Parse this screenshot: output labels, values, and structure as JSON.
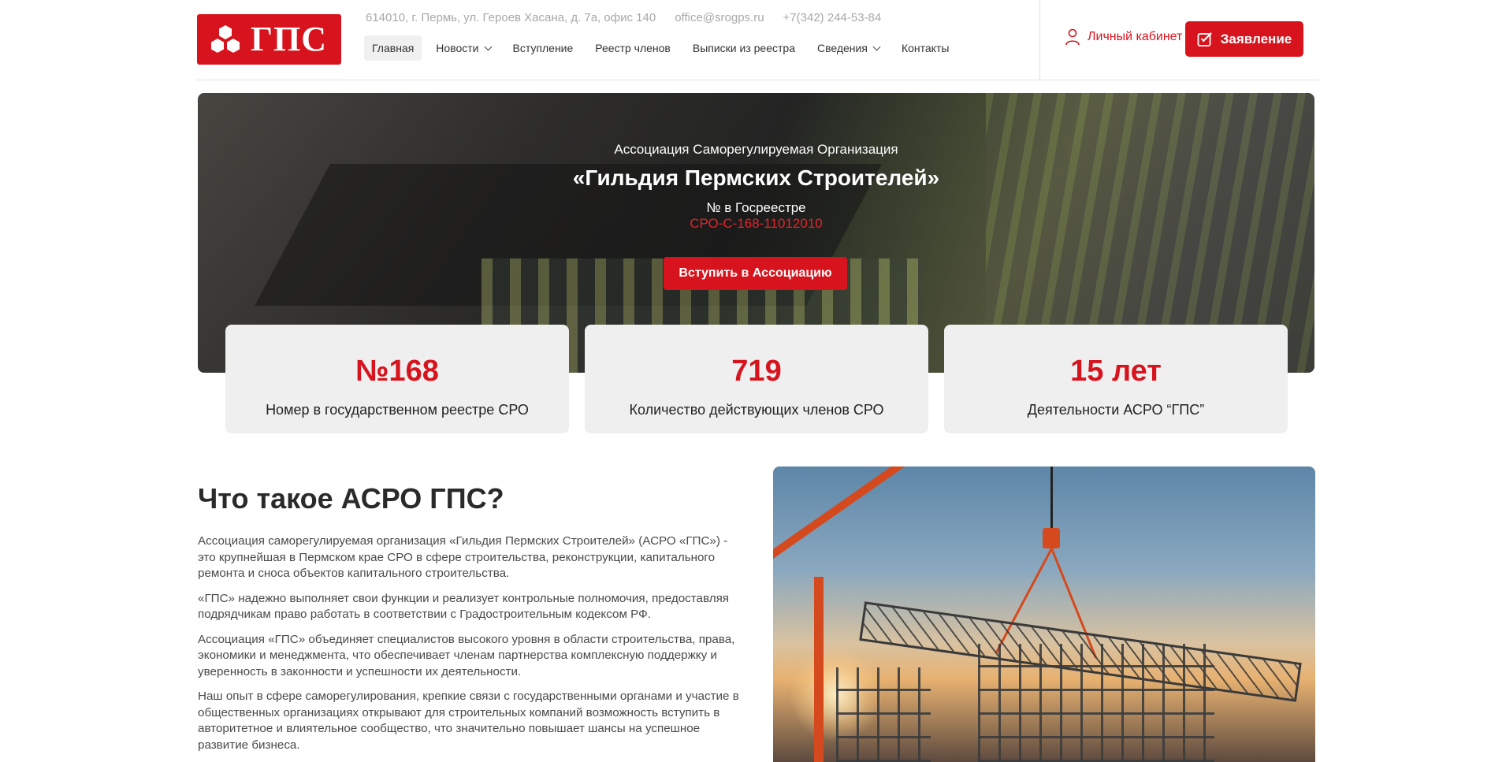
{
  "brand": {
    "logo_text": "ГПС",
    "accent": "#d7141d"
  },
  "header": {
    "address": "614010, г. Пермь, ул. Героев Хасана, д. 7а, офис 140",
    "email": "office@srogps.ru",
    "phone": "+7(342) 244-53-84",
    "nav": [
      {
        "label": "Главная",
        "active": true
      },
      {
        "label": "Новости",
        "dropdown": true
      },
      {
        "label": "Вступление"
      },
      {
        "label": "Реестр членов"
      },
      {
        "label": "Выписки из реестра"
      },
      {
        "label": "Сведения",
        "dropdown": true
      },
      {
        "label": "Контакты"
      }
    ],
    "cabinet_label": "Личный кабинет",
    "cabinet_icon": "user-icon",
    "apply_label": "Заявление",
    "apply_icon": "edit-icon"
  },
  "hero": {
    "subtitle": "Ассоциация Саморегулируемая Организация",
    "title": "«Гильдия Пермских Строителей»",
    "registry_label": "№ в Госреестре",
    "registry_code": "СРО-С-168-11012010",
    "join_label": "Вступить в Ассоциацию"
  },
  "stats": [
    {
      "value": "№168",
      "label": "Номер в государственном реестре СРО"
    },
    {
      "value": "719",
      "label": "Количество действующих членов СРО"
    },
    {
      "value": "15 лет",
      "label": "Деятельности АСРО “ГПС”"
    }
  ],
  "about": {
    "title": "Что такое АСРО ГПС?",
    "paragraphs": [
      "Ассоциация саморегулируемая организация «Гильдия Пермских Строителей» (АСРО «ГПС») - это крупнейшая в Пермском крае СРО в сфере строительства, реконструкции, капитального ремонта и сноса объектов капитального строительства.",
      "«ГПС» надежно выполняет свои функции и реализует контрольные полномочия, предоставляя подрядчикам право работать в соответствии с Градостроительным кодексом РФ.",
      "Ассоциация «ГПС» объединяет специалистов высокого уровня в области строительства, права, экономики и менеджмента, что обеспечивает членам партнерства комплексную поддержку и уверенность в законности и успешности их деятельности.",
      "Наш опыт в сфере саморегулирования, крепкие связи с государственными органами и участие в общественных организациях открывают для строительных компаний возможность вступить в авторитетное и влиятельное сообщество, что значительно повышает шансы на успешное развитие бизнеса."
    ]
  }
}
